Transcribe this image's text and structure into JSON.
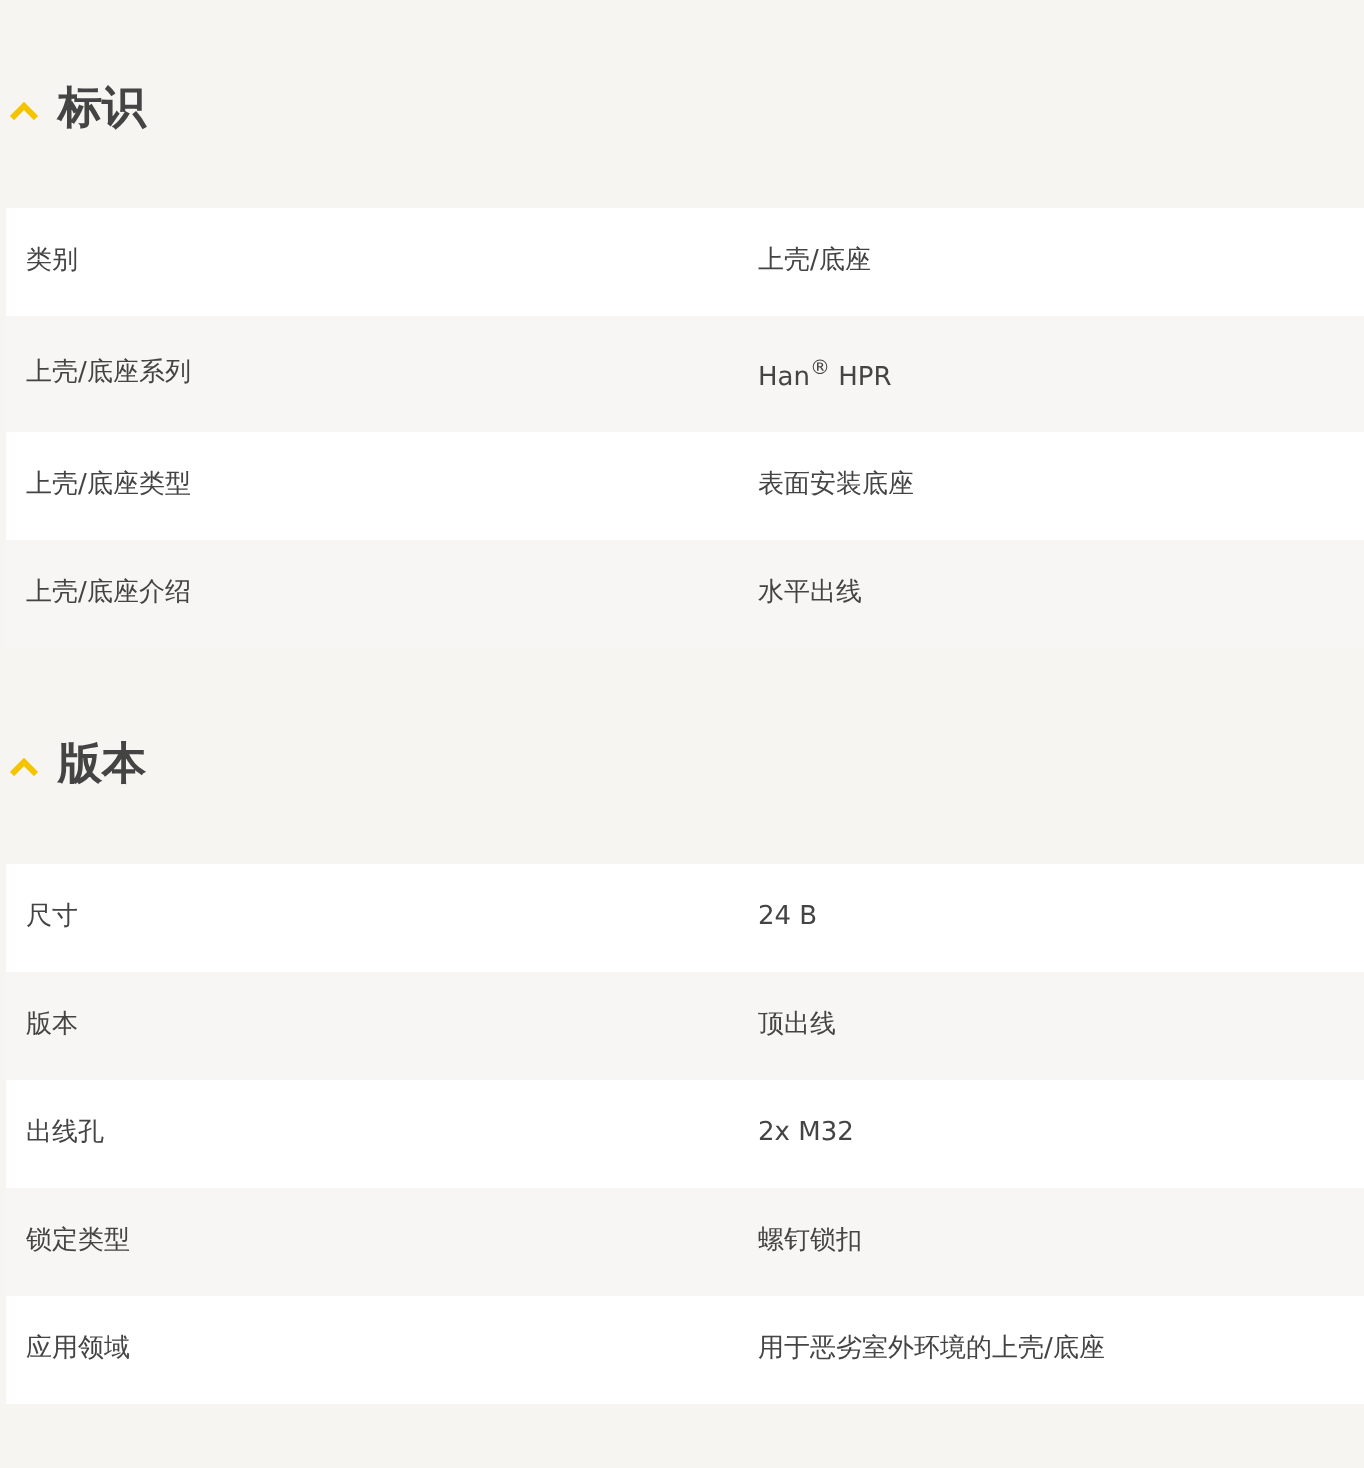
{
  "sections": [
    {
      "title": "标识",
      "expanded": true,
      "rows": [
        {
          "label": "类别",
          "value": "上壳/底座"
        },
        {
          "label": "上壳/底座系列",
          "value": "Han$^{®}$ HPR"
        },
        {
          "label": "上壳/底座类型",
          "value": "表面安装底座"
        },
        {
          "label": "上壳/底座介绍",
          "value": "水平出线"
        }
      ]
    },
    {
      "title": "版本",
      "expanded": true,
      "rows": [
        {
          "label": "尺寸",
          "value": "24 B"
        },
        {
          "label": "版本",
          "value": "顶出线"
        },
        {
          "label": "出线孔",
          "value": "2x M32"
        },
        {
          "label": "锁定类型",
          "value": "螺钉锁扣"
        },
        {
          "label": "应用领域",
          "value": "用于恶劣室外环境的上壳/底座"
        }
      ]
    }
  ]
}
